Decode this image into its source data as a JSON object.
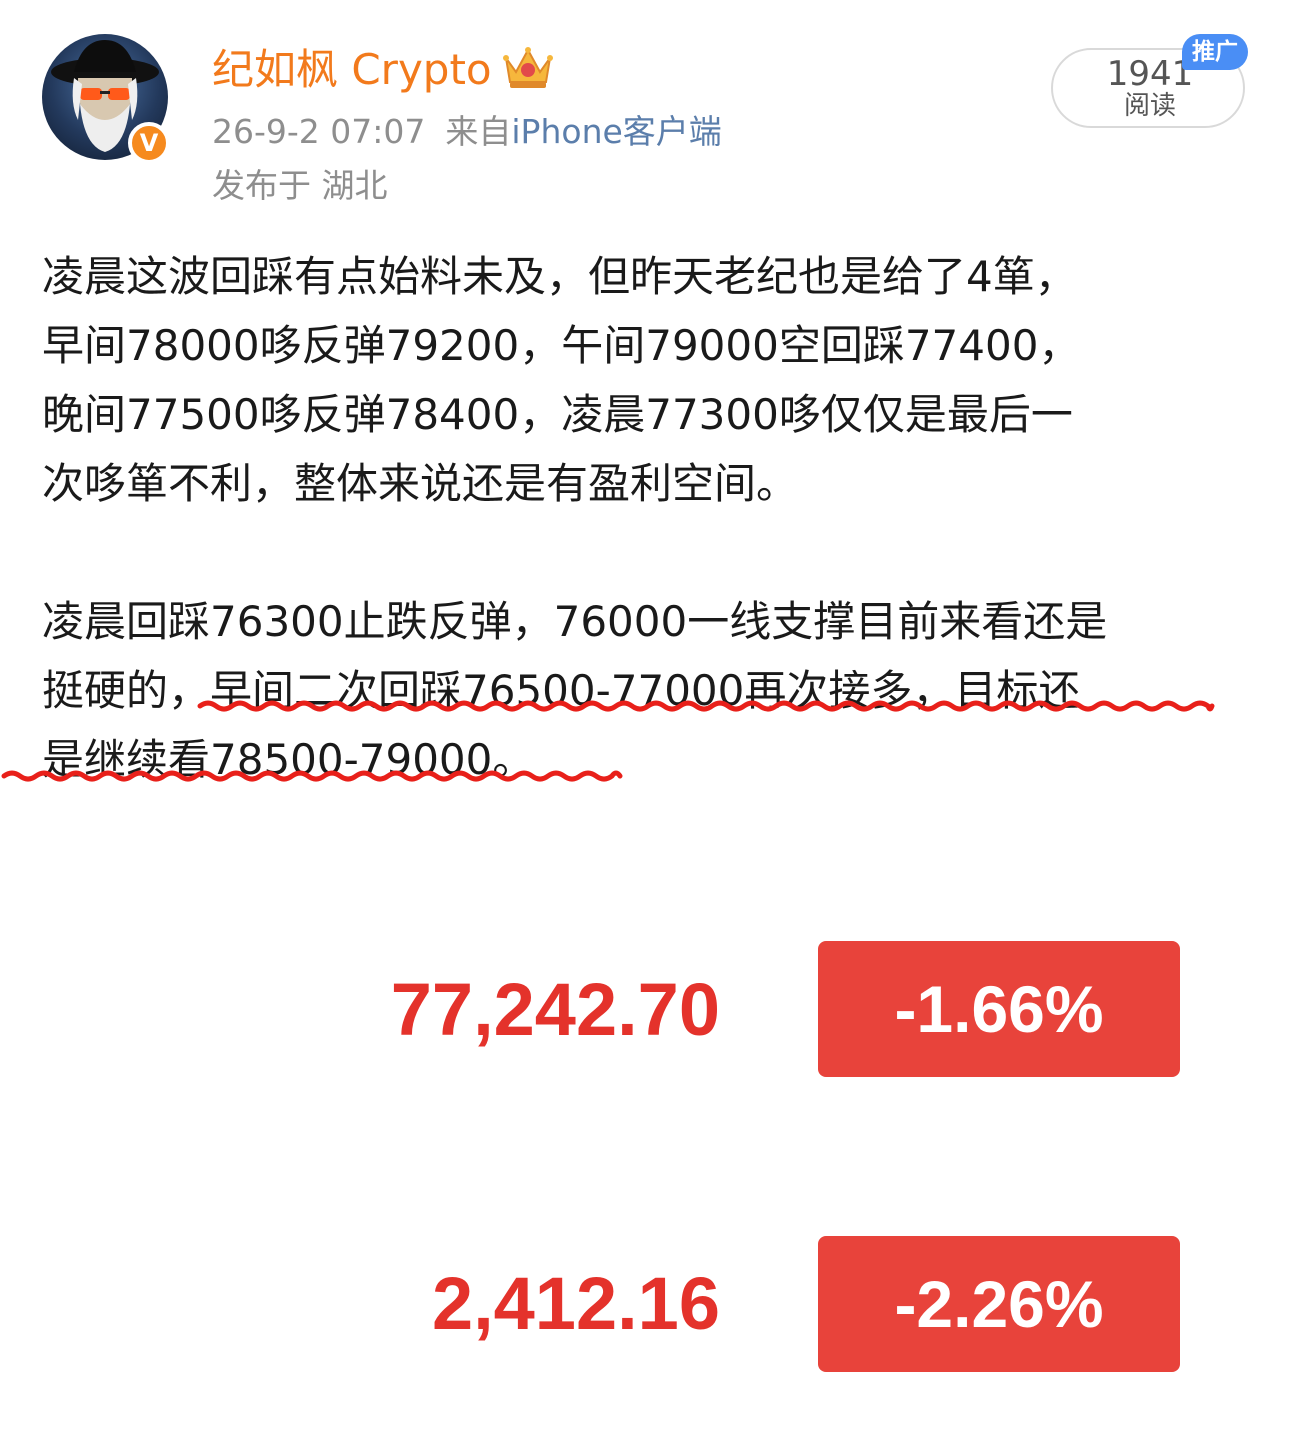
{
  "post": {
    "author": {
      "name": "纪如枫 Crypto",
      "avatar": "avatar",
      "verified_icon": "verified-v-icon",
      "verified_mark": "V",
      "member_icon": "crown-icon"
    },
    "timestamp": "26-9-2 07:07",
    "source_prefix": "来自",
    "source": "iPhone客户端",
    "location": "发布于 湖北",
    "read_count": "1941",
    "read_label": "阅读",
    "promo_tag": "推广",
    "paragraphs": [
      [
        "凌晨这波回踩有点始料未及，但昨天老纪也是给了4箪，",
        "早间78000哆反弹79200，午间79000空回踩77400，",
        "晚间77500哆反弹78400，凌晨77300哆仅仅是最后一",
        "次哆箪不利，整体来说还是有盈利空间。"
      ],
      [
        "凌晨回踩76300止跌反弹，76000一线支撑目前来看还是",
        "挺硬的，早间二次回踩76500-77000再次接多，目标还",
        "是继续看78500-79000。"
      ]
    ],
    "annotation": {
      "type": "red-wavy-underline",
      "color": "#e8201a"
    }
  },
  "prices": [
    {
      "value": "77,242.70",
      "change": "-1.66%"
    },
    {
      "value": "2,412.16",
      "change": "-2.26%"
    }
  ],
  "colors": {
    "username": "#f27a1c",
    "meta": "#8e8e8e",
    "source_link": "#5b7eab",
    "price_red": "#e4322b",
    "badge_red": "#e8433b",
    "promo_blue": "#4a8ef5",
    "verified_orange": "#f68a1e"
  }
}
